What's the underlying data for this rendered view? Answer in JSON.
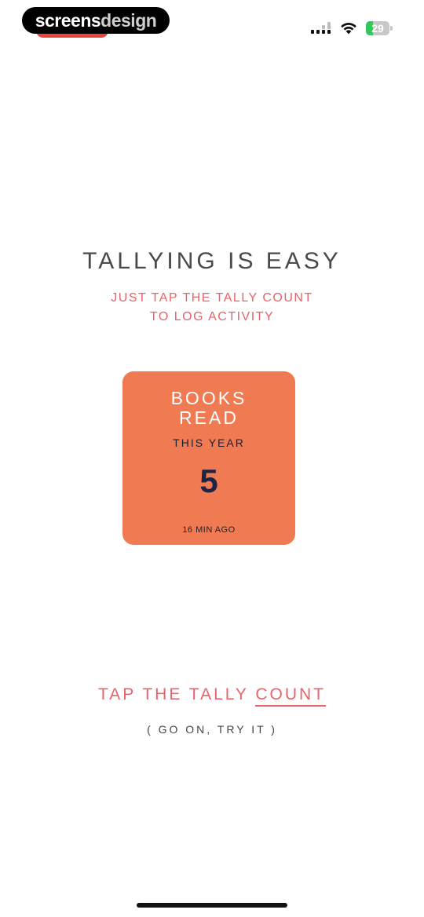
{
  "status_bar": {
    "watermark_part1": "screens",
    "watermark_part2": "design",
    "battery_level": "29",
    "battery_fraction": 0.29,
    "icons": [
      "cellular-signal-icon",
      "wifi-icon",
      "battery-charging-icon"
    ],
    "colors": {
      "time_pill": "#e8443a",
      "battery_fill": "#34c759"
    }
  },
  "intro": {
    "title": "TALLYING IS EASY",
    "subtitle_line1": "JUST TAP THE TALLY COUNT",
    "subtitle_line2": "TO LOG ACTIVITY"
  },
  "tally_card": {
    "title_line1": "BOOKS",
    "title_line2": "READ",
    "period": "THIS YEAR",
    "count": "5",
    "last_updated": "16 MIN AGO",
    "color": "#f07a51"
  },
  "cta": {
    "prefix": "TAP THE TALLY ",
    "underlined": "COUNT",
    "hint": "( GO ON, TRY IT )"
  },
  "theme": {
    "accent": "#e8636a",
    "text_dark": "#4a4a4a",
    "count_color": "#1d2545"
  }
}
